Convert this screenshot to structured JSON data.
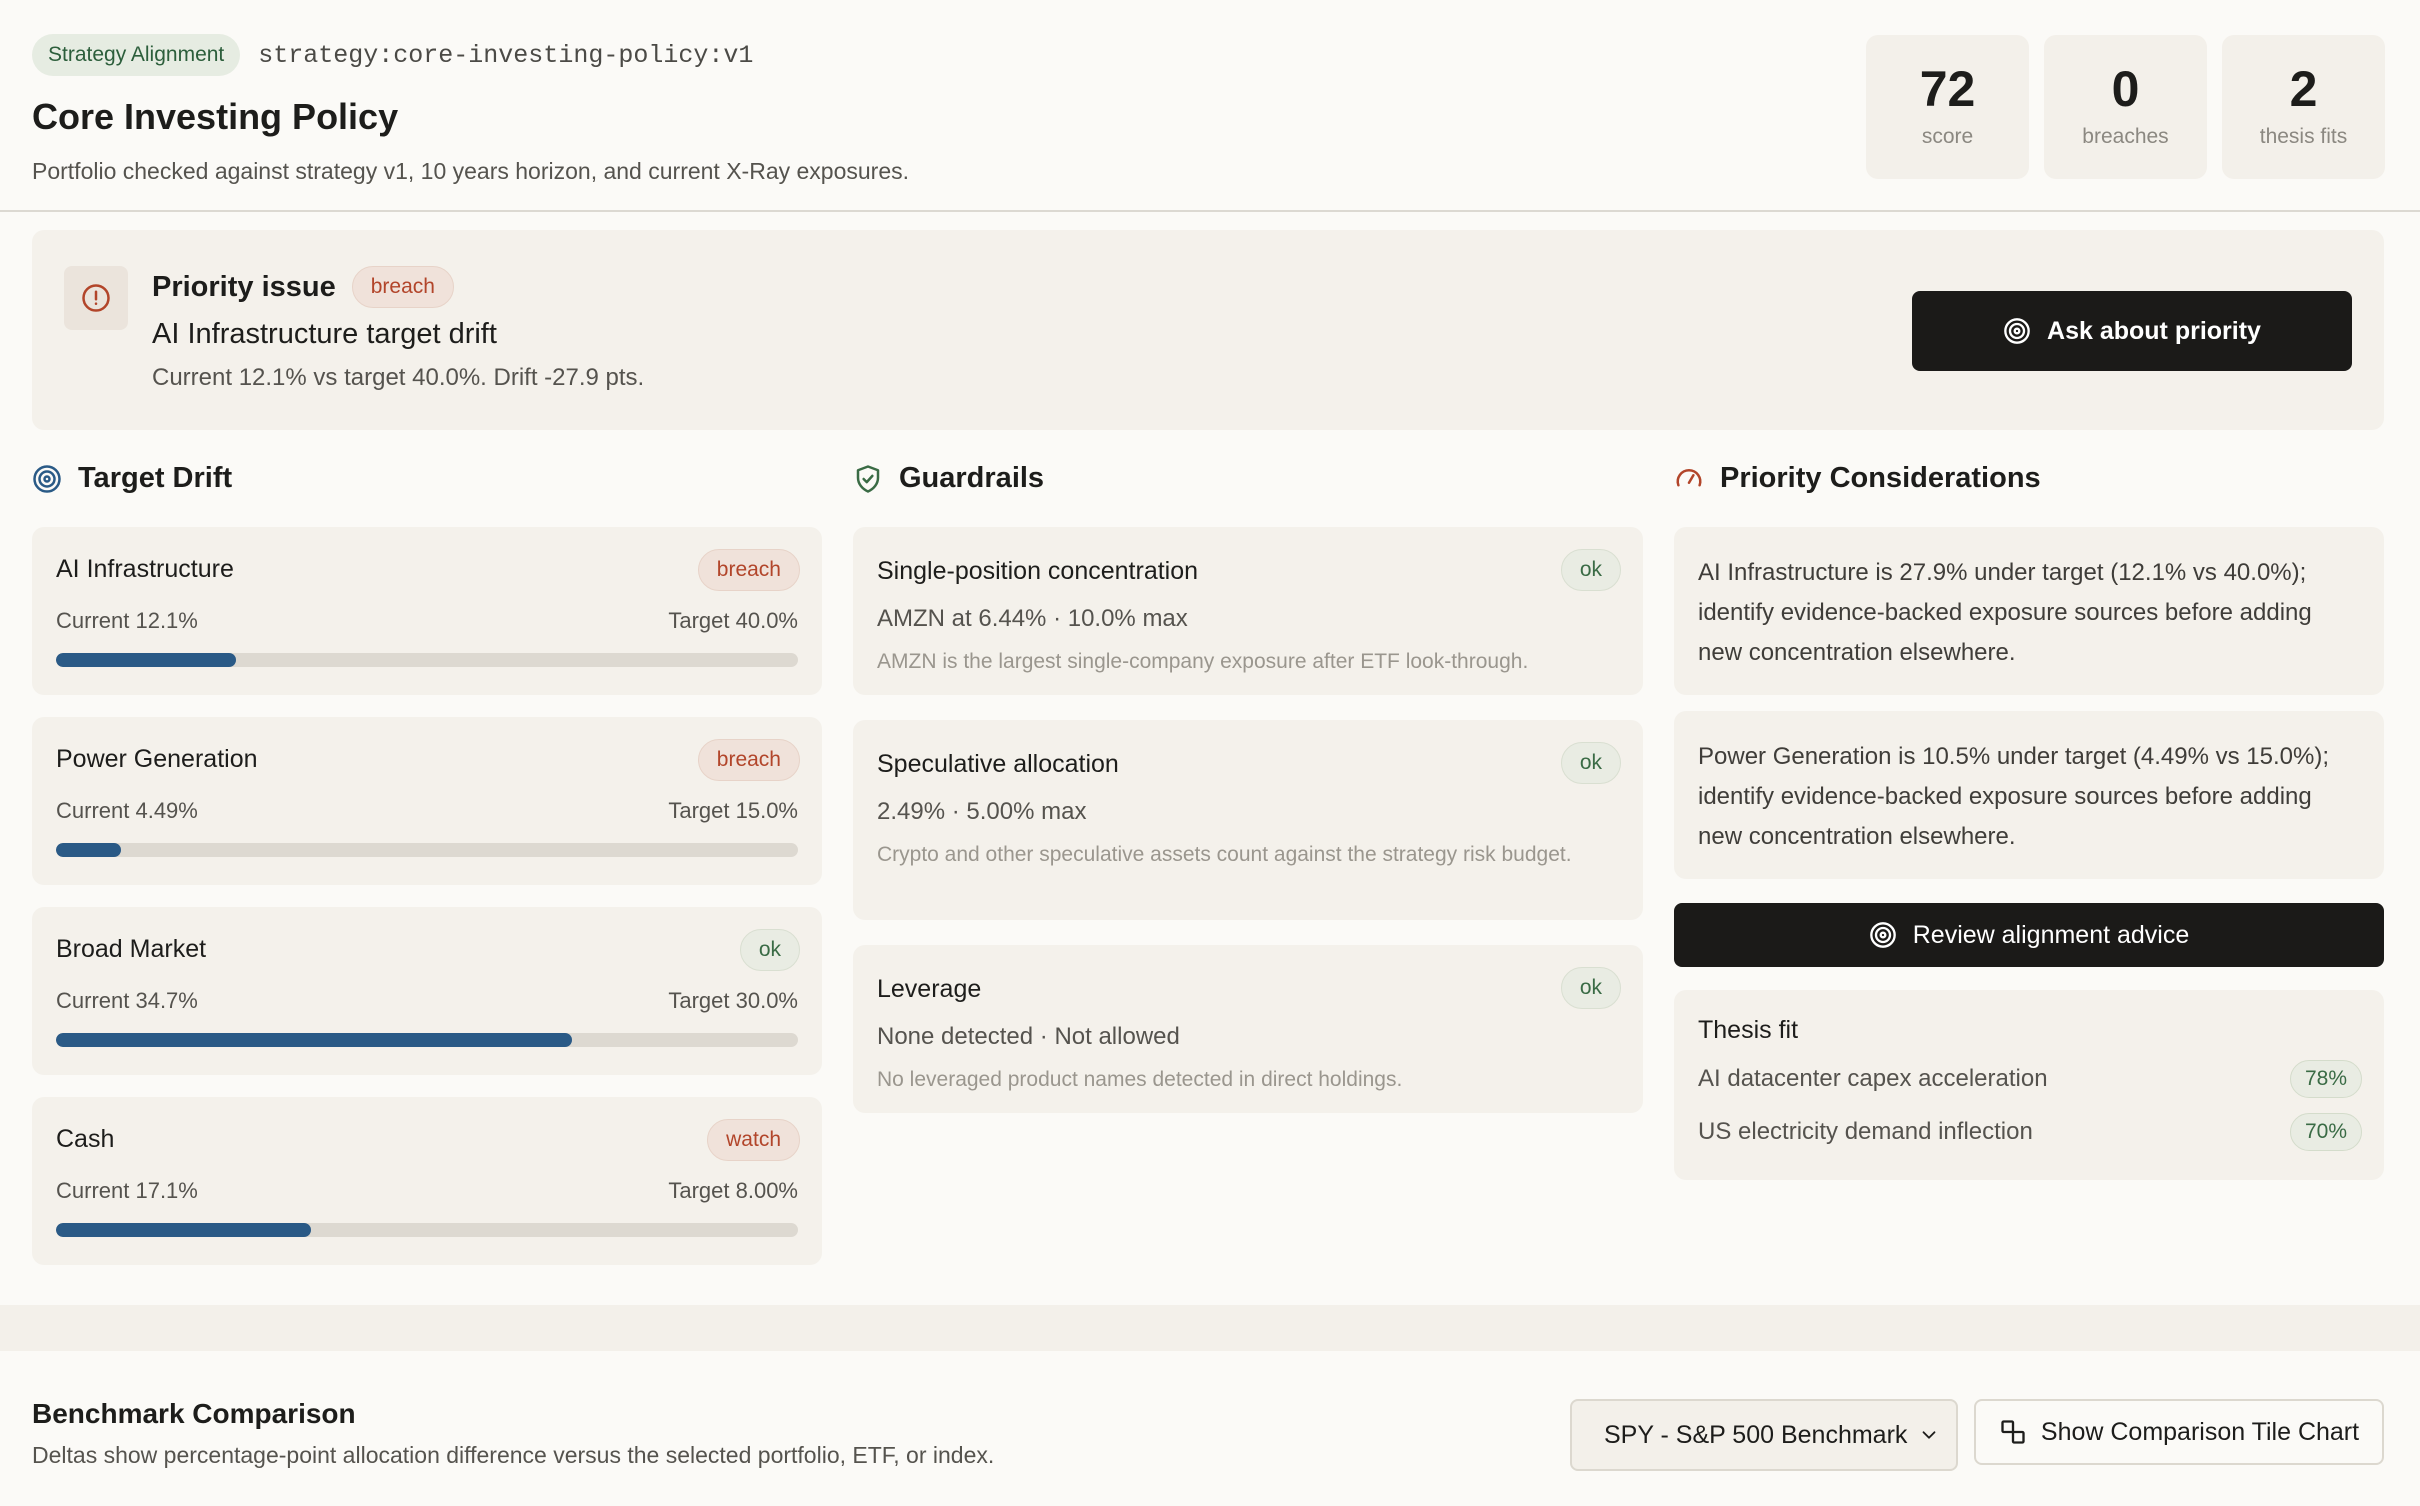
{
  "header": {
    "badge": "Strategy Alignment",
    "strategy_id": "strategy:core-investing-policy:v1",
    "title": "Core Investing Policy",
    "subtitle": "Portfolio checked against strategy v1, 10 years horizon, and current X-Ray exposures.",
    "stats": [
      {
        "value": "72",
        "label": "score"
      },
      {
        "value": "0",
        "label": "breaches"
      },
      {
        "value": "2",
        "label": "thesis fits"
      }
    ]
  },
  "priority": {
    "title": "Priority issue",
    "status": "breach",
    "headline": "AI Infrastructure target drift",
    "detail": "Current 12.1% vs target 40.0%. Drift -27.9 pts.",
    "button_label": "Ask about priority",
    "icon": "alert-circle-icon"
  },
  "target_drift": {
    "heading": "Target Drift",
    "icon": "target-icon",
    "items": [
      {
        "name": "AI Infrastructure",
        "status": "breach",
        "current": "Current 12.1%",
        "target": "Target 40.0%",
        "progress": 0.243
      },
      {
        "name": "Power Generation",
        "status": "breach",
        "current": "Current 4.49%",
        "target": "Target 15.0%",
        "progress": 0.088
      },
      {
        "name": "Broad Market",
        "status": "ok",
        "current": "Current 34.7%",
        "target": "Target 30.0%",
        "progress": 0.695
      },
      {
        "name": "Cash",
        "status": "watch",
        "current": "Current 17.1%",
        "target": "Target 8.00%",
        "progress": 0.343
      }
    ]
  },
  "guardrails": {
    "heading": "Guardrails",
    "icon": "shield-check-icon",
    "items": [
      {
        "title": "Single-position concentration",
        "status": "ok",
        "value": "AMZN at 6.44% · 10.0% max",
        "note": "AMZN is the largest single-company exposure after ETF look-through."
      },
      {
        "title": "Speculative allocation",
        "status": "ok",
        "value": "2.49% · 5.00% max",
        "note": "Crypto and other speculative assets count against the strategy risk budget."
      },
      {
        "title": "Leverage",
        "status": "ok",
        "value": "None detected · Not allowed",
        "note": "No leveraged product names detected in direct holdings."
      }
    ]
  },
  "considerations": {
    "heading": "Priority Considerations",
    "icon": "gauge-icon",
    "items": [
      "AI Infrastructure is 27.9% under target (12.1% vs 40.0%); identify evidence-backed exposure sources before adding new concentration elsewhere.",
      "Power Generation is 10.5% under target (4.49% vs 15.0%); identify evidence-backed exposure sources before adding new concentration elsewhere."
    ],
    "button_label": "Review alignment advice"
  },
  "thesis_fit": {
    "title": "Thesis fit",
    "items": [
      {
        "label": "AI datacenter capex acceleration",
        "pct": "78%"
      },
      {
        "label": "US electricity demand inflection",
        "pct": "70%"
      }
    ]
  },
  "benchmark": {
    "title": "Benchmark Comparison",
    "subtitle": "Deltas show percentage-point allocation difference versus the selected portfolio, ETF, or index.",
    "selected": "SPY - S&P 500 Benchmark",
    "button_label": "Show Comparison Tile Chart"
  },
  "colors": {
    "accent_dark": "#1b1a18",
    "bar_fill": "#2a5a86",
    "breach": "#b2452a",
    "ok": "#3a6b45"
  }
}
